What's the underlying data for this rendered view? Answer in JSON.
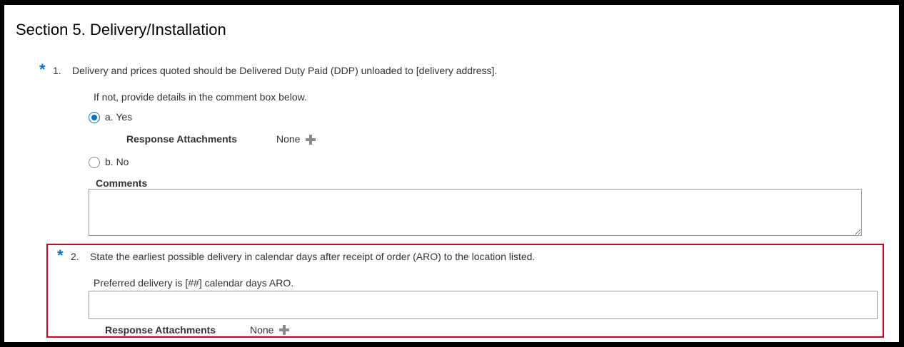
{
  "section": {
    "title": "Section 5. Delivery/Installation"
  },
  "questions": [
    {
      "required_marker": "*",
      "number": "1.",
      "text": "Delivery and prices quoted should be Delivered Duty Paid (DDP) unloaded to [delivery address].",
      "instruction": "If not, provide details in the comment box below.",
      "options": [
        {
          "label": "a. Yes",
          "selected": true
        },
        {
          "label": "b. No",
          "selected": false
        }
      ],
      "attachments": {
        "label": "Response Attachments",
        "value": "None"
      },
      "comments_label": "Comments",
      "comments_value": ""
    },
    {
      "required_marker": "*",
      "number": "2.",
      "text": "State the earliest possible delivery in calendar days after receipt of order (ARO) to the location listed.",
      "instruction": "Preferred delivery is [##] calendar days ARO.",
      "answer_value": "",
      "attachments": {
        "label": "Response Attachments",
        "value": "None"
      }
    }
  ],
  "colors": {
    "required": "#0572ce",
    "radio_selected": "#0572ce",
    "highlight_border": "#d0021b"
  },
  "icons": {
    "add_attachment": "plus-icon"
  }
}
